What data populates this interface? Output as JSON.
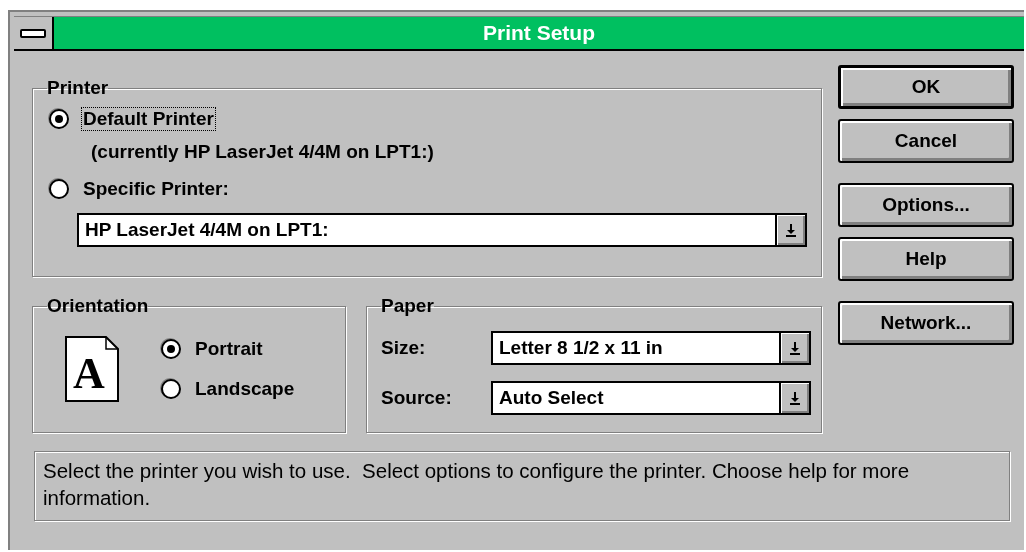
{
  "window": {
    "title": "Print Setup"
  },
  "printer": {
    "label": "Printer",
    "options": [
      {
        "label": "Default Printer",
        "selected": true,
        "focused": true
      },
      {
        "label": "Specific Printer:",
        "selected": false,
        "focused": false
      }
    ],
    "current": "(currently HP LaserJet 4/4M on LPT1:)",
    "printer_select": {
      "value": "HP LaserJet 4/4M on LPT1:"
    }
  },
  "orientation": {
    "label": "Orientation",
    "icon_letter": "A",
    "options": [
      {
        "label": "Portrait",
        "selected": true,
        "focused": false
      },
      {
        "label": "Landscape",
        "selected": false,
        "focused": false
      }
    ]
  },
  "paper": {
    "label": "Paper",
    "fields": [
      {
        "label": "Size:",
        "value": "Letter 8 1/2 x 11 in"
      },
      {
        "label": "Source:",
        "value": "Auto Select"
      }
    ]
  },
  "buttons": [
    {
      "label": "OK",
      "default": true
    },
    {
      "label": "Cancel",
      "default": false
    },
    {
      "label": "Options...",
      "default": false
    },
    {
      "label": "Help",
      "default": false
    },
    {
      "label": "Network...",
      "default": false
    }
  ],
  "status": "Select the printer you wish to use.  Select options to configure the printer. Choose help for more information."
}
